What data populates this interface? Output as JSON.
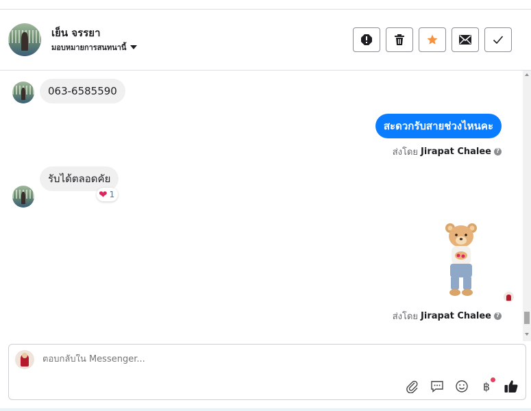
{
  "header": {
    "contact_name": "เย็น จรรยา",
    "assign_label": "มอบหมายการสนทนานี้",
    "actions": [
      {
        "name": "report-button",
        "icon": "exclamation-icon"
      },
      {
        "name": "delete-button",
        "icon": "trash-icon"
      },
      {
        "name": "star-button",
        "icon": "star-icon"
      },
      {
        "name": "mark-unread-button",
        "icon": "envelope-icon"
      },
      {
        "name": "mark-done-button",
        "icon": "check-icon"
      }
    ]
  },
  "messages": {
    "m1": {
      "text": "063-6585590"
    },
    "m2": {
      "text": "สะดวกรับสายช่วงไหนคะ",
      "sent_by_prefix": "ส่งโดย",
      "sent_by_name": "Jirapat Chalee"
    },
    "m3": {
      "text": "รับได้ตลอดคัย",
      "reaction_count": "1"
    },
    "m4": {
      "sticker": "teddy-bear-sticker",
      "sent_by_prefix": "ส่งโดย",
      "sent_by_name": "Jirapat Chalee"
    }
  },
  "composer": {
    "placeholder": "ตอบกลับใน Messenger...",
    "tools": [
      "paperclip-icon",
      "chat-bubble-icon",
      "smiley-icon",
      "baht-icon",
      "thumbs-up-icon"
    ]
  },
  "colors": {
    "accent": "#0a7cff",
    "star": "#f5923e",
    "heart": "#e0245e"
  }
}
